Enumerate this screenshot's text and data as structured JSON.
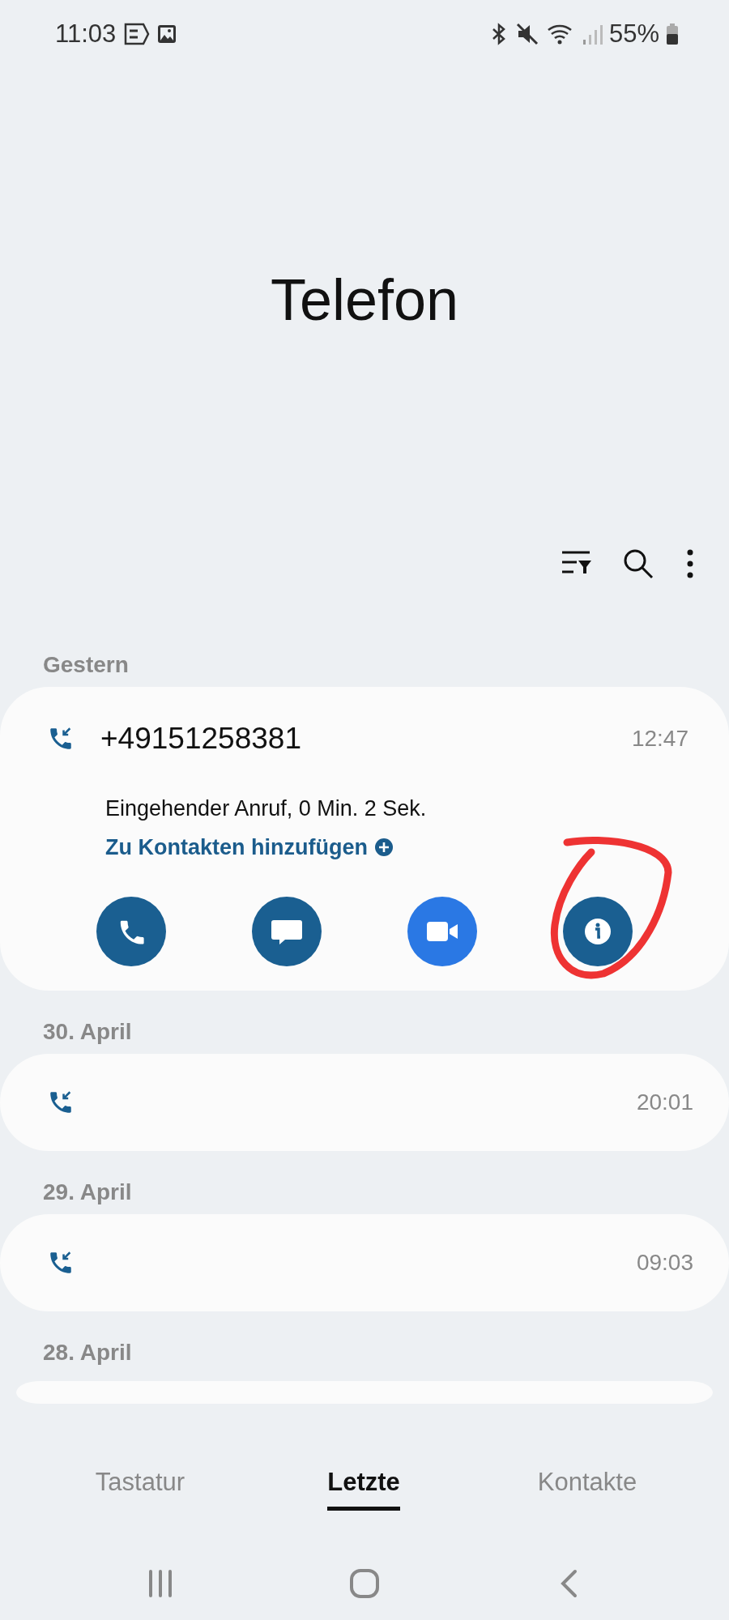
{
  "status_bar": {
    "time": "11:03",
    "battery": "55%"
  },
  "header": {
    "title": "Telefon"
  },
  "call_log": [
    {
      "date": "Gestern",
      "calls": [
        {
          "kind": "expanded",
          "number": "+49151258381",
          "time": "12:47",
          "description": "Eingehender Anruf, 0 Min. 2 Sek.",
          "link": "Zu Kontakten hinzufügen",
          "actions": [
            {
              "kind": "call",
              "circled": false
            },
            {
              "kind": "message",
              "circled": false
            },
            {
              "kind": "video",
              "circled": false
            },
            {
              "kind": "info",
              "circled": true
            }
          ]
        }
      ]
    },
    {
      "date": "30. April",
      "calls": [
        {
          "kind": "collapsed",
          "time": "20:01"
        }
      ]
    },
    {
      "date": "29. April",
      "calls": [
        {
          "kind": "collapsed",
          "time": "09:03"
        }
      ]
    },
    {
      "date": "28. April",
      "calls": [
        {
          "kind": "partial"
        }
      ]
    }
  ],
  "tabs": [
    {
      "label": "Tastatur",
      "selected": false
    },
    {
      "label": "Letzte",
      "selected": true
    },
    {
      "label": "Kontakte",
      "selected": false
    }
  ]
}
